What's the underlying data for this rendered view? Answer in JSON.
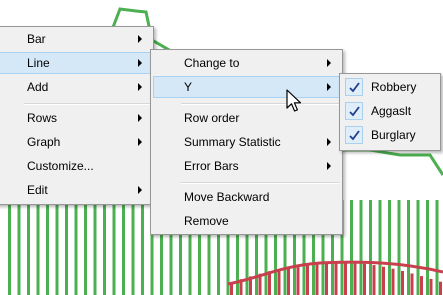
{
  "colors": {
    "menu_bg": "#f0f0f0",
    "menu_border": "#979797",
    "highlight_bg": "#d5e8f8",
    "highlight_border": "#a8d1f3",
    "series_green": "#4caf50",
    "series_red": "#c8404e",
    "check_blue": "#1f3f8f"
  },
  "context_menu": {
    "items": [
      {
        "label": "Bar",
        "submenu": true
      },
      {
        "label": "Line",
        "submenu": true,
        "highlighted": true
      },
      {
        "label": "Add",
        "submenu": true
      },
      {
        "label": "Rows",
        "submenu": true
      },
      {
        "label": "Graph",
        "submenu": true
      },
      {
        "label": "Customize...",
        "submenu": false
      },
      {
        "label": "Edit",
        "submenu": true
      }
    ]
  },
  "line_submenu": {
    "items": [
      {
        "label": "Change to",
        "submenu": true
      },
      {
        "label": "Y",
        "submenu": true,
        "highlighted": true
      },
      {
        "label": "Row order",
        "submenu": false
      },
      {
        "label": "Summary Statistic",
        "submenu": true
      },
      {
        "label": "Error Bars",
        "submenu": true
      },
      {
        "label": "Move Backward",
        "submenu": false
      },
      {
        "label": "Remove",
        "submenu": false
      }
    ]
  },
  "y_submenu": {
    "items": [
      {
        "label": "Robbery",
        "checked": true,
        "icon": "checkmark-icon"
      },
      {
        "label": "Aggaslt",
        "checked": true,
        "icon": "checkmark-icon"
      },
      {
        "label": "Burglary",
        "checked": true,
        "icon": "checkmark-icon"
      }
    ]
  },
  "cursor": {
    "icon": "mouse-pointer-icon"
  }
}
